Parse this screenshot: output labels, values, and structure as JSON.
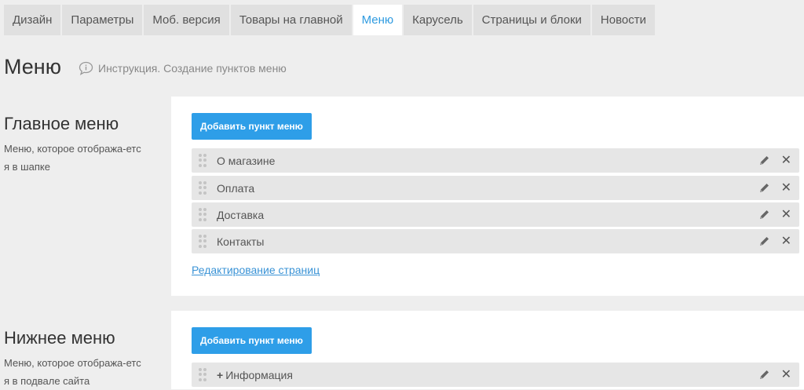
{
  "tabs": [
    {
      "label": "Дизайн"
    },
    {
      "label": "Параметры"
    },
    {
      "label": "Моб. версия"
    },
    {
      "label": "Товары на главной"
    },
    {
      "label": "Меню"
    },
    {
      "label": "Карусель"
    },
    {
      "label": "Страницы и блоки"
    },
    {
      "label": "Новости"
    }
  ],
  "active_tab": "Меню",
  "page": {
    "title": "Меню",
    "instruction": "Инструкция. Создание пунктов меню"
  },
  "main_menu": {
    "title": "Главное меню",
    "description": "Меню, которое отобража-ется в шапке",
    "add_button": "Добавить пункт меню",
    "items": [
      {
        "label": "О магазине"
      },
      {
        "label": "Оплата"
      },
      {
        "label": "Доставка"
      },
      {
        "label": "Контакты"
      }
    ],
    "edit_link": "Редактирование страниц"
  },
  "footer_menu": {
    "title": "Нижнее меню",
    "description": "Меню, которое отобража-ется в подвале сайта",
    "add_button": "Добавить пункт меню",
    "items": [
      {
        "label": "Информация",
        "expandable": true
      }
    ]
  },
  "colors": {
    "accent": "#2e9ee8",
    "link": "#3a93d6",
    "background": "#eeeeee"
  }
}
